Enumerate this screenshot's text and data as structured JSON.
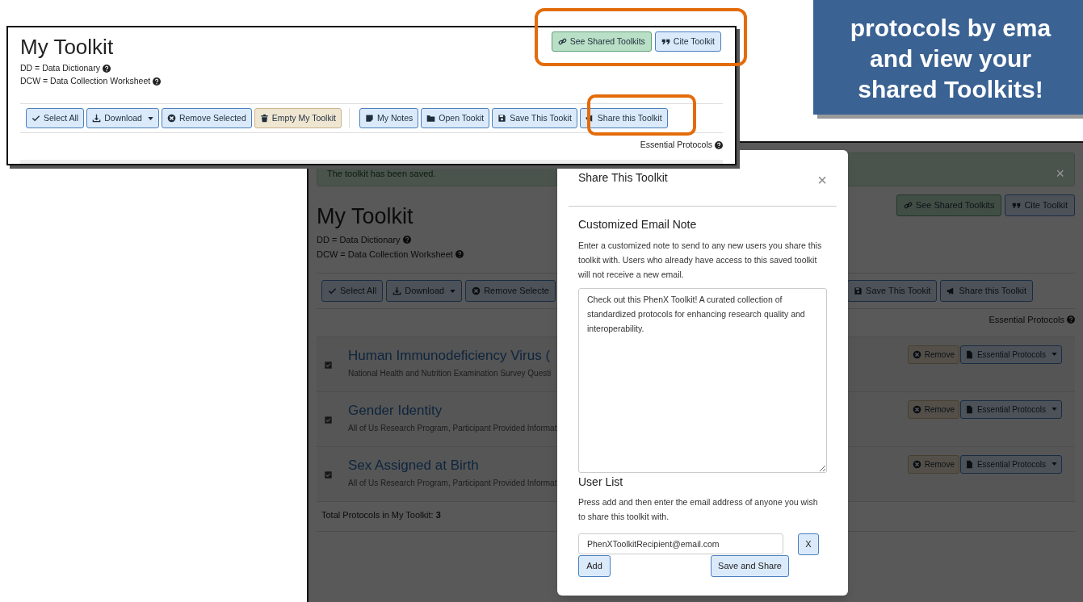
{
  "callout": {
    "lines": [
      "protocols by ema",
      "and view your",
      "shared Toolkits!"
    ]
  },
  "back": {
    "alert": {
      "text": "The toolkit has been saved.",
      "close": "×"
    },
    "title": "My Toolkit",
    "legend": [
      "DD = Data Dictionary",
      "DCW = Data Collection Worksheet"
    ],
    "top_buttons": [
      {
        "label": "See Shared Toolkits",
        "kind": "success"
      },
      {
        "label": "Cite Toolkit",
        "kind": "primary"
      }
    ],
    "toolbar_left": [
      {
        "label": "Select All",
        "kind": "primary",
        "dropdown": false
      },
      {
        "label": "Download",
        "kind": "primary",
        "dropdown": true
      },
      {
        "label": "Remove Selecte",
        "kind": "primary",
        "dropdown": false
      }
    ],
    "toolbar_right": [
      {
        "label": "Save This Tookit",
        "kind": "primary",
        "dropdown": false
      },
      {
        "label": "Share this Toolkit",
        "kind": "primary",
        "dropdown": false
      }
    ],
    "essential_label": "Essential Protocols",
    "protocols": [
      {
        "title": "Human Immunodeficiency Virus (",
        "source": "National Health and Nutrition Examination Survey Questi",
        "checked": true,
        "remove": "Remove",
        "menu": "Essential Protocols"
      },
      {
        "title": "Gender Identity",
        "source": "All of Us Research Program, Participant Provided Informat",
        "checked": true,
        "remove": "Remove",
        "menu": "Essential Protocols"
      },
      {
        "title": "Sex Assigned at Birth",
        "source": "All of Us Research Program, Participant Provided Informat",
        "checked": true,
        "remove": "Remove",
        "menu": "Essential Protocols"
      }
    ],
    "total": "Total Protocols in My Toolkit: **3**"
  },
  "modal": {
    "title": "Share This Toolkit",
    "close": "×",
    "note_heading": "Customized Email Note",
    "note_help": "Enter a customized note to send to any new users you share this toolkit with. Users who already have access to this saved toolkit will not receive a new email.",
    "note_value": "Check out this PhenX Toolkit! A curated collection of standardized protocols for enhancing research quality and interoperability.",
    "users_heading": "User List",
    "users_help": "Press add and then enter the email address of anyone you wish to share this toolkit with.",
    "email_value": "PhenXToolkitRecipient@email.com",
    "remove_email": "X",
    "add": "Add",
    "save": "Save and Share"
  },
  "front": {
    "title": "My Toolkit",
    "legend": [
      "DD = Data Dictionary",
      "DCW = Data Collection Worksheet"
    ],
    "top_buttons": [
      {
        "label": "See Shared Toolkits",
        "kind": "success"
      },
      {
        "label": "Cite Toolkit",
        "kind": "primary"
      }
    ],
    "toolbar_groups": [
      [
        {
          "label": "Select All",
          "kind": "primary",
          "dropdown": false
        },
        {
          "label": "Download",
          "kind": "primary",
          "dropdown": true
        },
        {
          "label": "Remove Selected",
          "kind": "primary",
          "dropdown": false
        },
        {
          "label": "Empty My Toolkit",
          "kind": "warning",
          "dropdown": false
        }
      ],
      [
        {
          "label": "My Notes",
          "kind": "primary",
          "dropdown": false
        },
        {
          "label": "Open Tookit",
          "kind": "primary",
          "dropdown": false
        },
        {
          "label": "Save This Tookit",
          "kind": "primary",
          "dropdown": false
        },
        {
          "label": "Share this Toolkit",
          "kind": "primary",
          "dropdown": false
        }
      ]
    ],
    "essential_label": "Essential Protocols"
  }
}
